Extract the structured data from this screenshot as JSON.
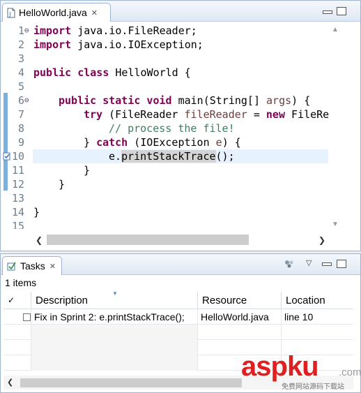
{
  "editor": {
    "tab_label": "HelloWorld.java",
    "lines": [
      {
        "no": "1",
        "fold": "⊖"
      },
      {
        "no": "2",
        "fold": ""
      },
      {
        "no": "3",
        "fold": ""
      },
      {
        "no": "4",
        "fold": ""
      },
      {
        "no": "5",
        "fold": ""
      },
      {
        "no": "6",
        "fold": "⊖"
      },
      {
        "no": "7",
        "fold": ""
      },
      {
        "no": "8",
        "fold": ""
      },
      {
        "no": "9",
        "fold": ""
      },
      {
        "no": "10",
        "fold": ""
      },
      {
        "no": "11",
        "fold": ""
      },
      {
        "no": "12",
        "fold": ""
      },
      {
        "no": "13",
        "fold": ""
      },
      {
        "no": "14",
        "fold": ""
      },
      {
        "no": "15",
        "fold": ""
      }
    ],
    "code": {
      "l1_kw": "import",
      "l1_rest": " java.io.FileReader;",
      "l2_kw": "import",
      "l2_rest": " java.io.IOException;",
      "l4_kw": "public class",
      "l4_rest": " HelloWorld {",
      "l6_kw": "public static void",
      "l6_rest": " main(String[] ",
      "l6_var": "args",
      "l6_end": ") {",
      "l7_kw": "try",
      "l7_a": " (FileReader ",
      "l7_var": "fileReader",
      "l7_b": " = ",
      "l7_kw2": "new",
      "l7_c": " FileRe",
      "l8_comment": "// process the file!",
      "l9_a": "} ",
      "l9_kw": "catch",
      "l9_b": " (IOException ",
      "l9_var": "e",
      "l9_c": ") {",
      "l10_a": "e.",
      "l10_mark": "printStackTrace",
      "l10_b": "();",
      "l11": "}",
      "l12": "}",
      "l14": "}"
    }
  },
  "tasks": {
    "tab_label": "Tasks",
    "items_count": "1 items",
    "columns": {
      "check": "✓",
      "description": "Description",
      "resource": "Resource",
      "location": "Location"
    },
    "rows": [
      {
        "description": "Fix in Sprint 2: e.printStackTrace();",
        "resource": "HelloWorld.java",
        "location": "line 10"
      }
    ]
  },
  "watermark": {
    "main_a": "asp",
    "main_b": "ku",
    "dot": ".com",
    "sub": "免费网站源码下载站"
  },
  "colors": {
    "keyword": "#7f0055",
    "comment": "#3f7f5f",
    "variable": "#6a3e3e",
    "current_line": "#e8f2fe",
    "watermark": "#e02020"
  }
}
